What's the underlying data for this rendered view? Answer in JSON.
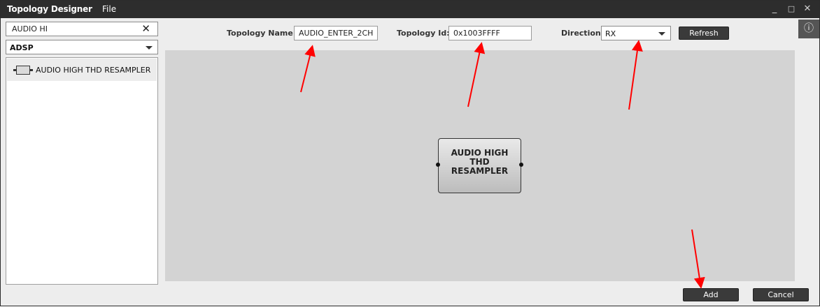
{
  "titlebar": {
    "app_title": "Topology Designer",
    "menu_file": "File",
    "minimize": "_",
    "maximize": "□",
    "close": "✕"
  },
  "left_panel": {
    "search_value": "AUDIO HI",
    "search_clear": "✕",
    "processor": "ADSP",
    "modules": [
      {
        "label": "AUDIO HIGH THD RESAMPLER",
        "icon": "module-block-icon"
      }
    ]
  },
  "header": {
    "topology_name_label": "Topology Name:",
    "topology_name_value": "AUDIO_ENTER_2CH",
    "topology_id_label": "Topology Id:",
    "topology_id_value": "0x1003FFFF",
    "direction_label": "Direction:",
    "direction_value": "RX",
    "refresh_label": "Refresh",
    "info_icon": "ⓘ"
  },
  "canvas": {
    "node": {
      "lines": [
        "AUDIO HIGH",
        "THD",
        "RESAMPLER"
      ]
    }
  },
  "footer": {
    "add_label": "Add",
    "cancel_label": "Cancel"
  },
  "colors": {
    "titlebar": "#2d2d2d",
    "canvas": "#d3d3d3",
    "button": "#3a3a3a",
    "annotation_arrow": "#ff0000"
  }
}
